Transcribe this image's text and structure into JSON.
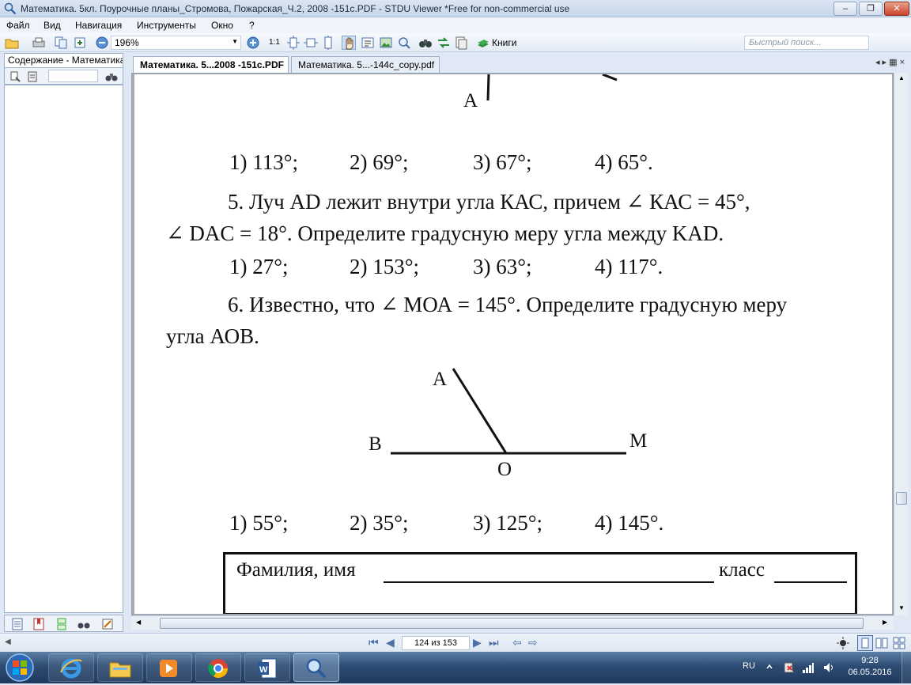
{
  "window": {
    "title": "Математика. 5кл. Поурочные планы_Стромова, Пожарская_Ч.2, 2008 -151с.PDF - STDU Viewer *Free for non-commercial use",
    "min": "–",
    "max": "❐",
    "close": "✕"
  },
  "menu": {
    "file": "Файл",
    "view": "Вид",
    "navigation": "Навигация",
    "tools": "Инструменты",
    "window": "Окно",
    "help": "?"
  },
  "toolbar": {
    "zoom": "196%",
    "one_to_one": "1:1",
    "books": "Книги",
    "search_placeholder": "Быстрый поиск..."
  },
  "left_panel": {
    "tab": "Содержание - Математика"
  },
  "tabs": [
    {
      "label": "Математика. 5...2008 -151с.PDF"
    },
    {
      "label": "Математика. 5...-144с_copy.pdf"
    }
  ],
  "tab_controls": "◂ ▸  ▦ ×",
  "document": {
    "top_label_A": "A",
    "q4_answers": [
      "1) 113°;",
      "2) 69°;",
      "3) 67°;",
      "4) 65°."
    ],
    "q5_line1": "5. Луч AD лежит внутри угла КАС, причем ∠ КАС = 45°,",
    "q5_line2": "∠ DAC = 18°. Определите градусную меру угла между KAD.",
    "q5_answers": [
      "1) 27°;",
      "2) 153°;",
      "3) 63°;",
      "4) 117°."
    ],
    "q6_line1": "6. Известно, что ∠ МОА = 145°. Определите градусную меру",
    "q6_line2": "угла АОВ.",
    "fig_labels": {
      "A": "A",
      "B": "B",
      "M": "M",
      "O": "O"
    },
    "q6_answers": [
      "1) 55°;",
      "2) 35°;",
      "3) 125°;",
      "4) 145°."
    ],
    "form_name": "Фамилия, имя",
    "form_class": "класс"
  },
  "statusbar": {
    "page": "124 из 153"
  },
  "tray": {
    "lang": "RU",
    "time": "9:28",
    "date": "06.05.2016"
  },
  "colors": {
    "chrome": "#dfe8f4",
    "taskbar": "#2d4b72",
    "accent": "#4a6fa8"
  }
}
